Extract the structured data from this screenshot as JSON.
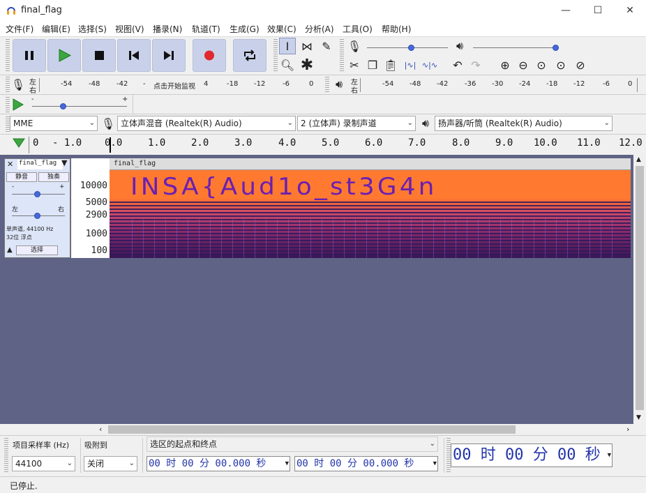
{
  "window": {
    "title": "final_flag",
    "minimize": "—",
    "maximize": "☐",
    "close": "✕"
  },
  "menu": [
    "文件(F)",
    "编辑(E)",
    "选择(S)",
    "视图(V)",
    "播录(N)",
    "轨道(T)",
    "生成(G)",
    "效果(C)",
    "分析(A)",
    "工具(O)",
    "帮助(H)"
  ],
  "transport": {
    "pause": "pause-icon",
    "play": "play-icon",
    "stop": "stop-icon",
    "skip_start": "skip-start-icon",
    "skip_end": "skip-end-icon",
    "record": "record-icon",
    "loop": "loop-icon"
  },
  "rec_meter": {
    "lr_top": "左",
    "lr_bottom": "右",
    "ticks": [
      "-54",
      "-48",
      "-42",
      "-",
      "4",
      "-18",
      "-12",
      "-6",
      "0"
    ],
    "prompt": "点击开始监视"
  },
  "play_meter": {
    "lr_top": "左",
    "lr_bottom": "右",
    "ticks": [
      "-54",
      "-48",
      "-42",
      "-36",
      "-30",
      "-24",
      "-18",
      "-12",
      "-6",
      "0"
    ]
  },
  "devices": {
    "host": "MME",
    "rec_device": "立体声混音 (Realtek(R) Audio)",
    "channels": "2 (立体声) 录制声道",
    "play_device": "扬声器/听筒 (Realtek(R) Audio)"
  },
  "ruler": {
    "labels": [
      "0",
      "- 1.0",
      "0.0",
      "1.0",
      "2.0",
      "3.0",
      "4.0",
      "5.0",
      "6.0",
      "7.0",
      "8.0",
      "9.0",
      "10.0",
      "11.0",
      "12.0"
    ]
  },
  "track": {
    "name": "final_flag",
    "mute": "静音",
    "solo": "独奏",
    "gain_minus": "-",
    "gain_plus": "+",
    "pan_left": "左",
    "pan_right": "右",
    "info1": "单声道, 44100 Hz",
    "info2": "32位 浮点",
    "select": "选择",
    "clip_name": "final_flag",
    "freq_labels": [
      "10000",
      "5000",
      "2900",
      "1000",
      "100"
    ],
    "spectrogram_text": "INSA{Aud1o_st3G4n"
  },
  "bottom": {
    "rate_label": "项目采样率 (Hz)",
    "rate_value": "44100",
    "snap_label": "吸附到",
    "snap_value": "关闭",
    "selection_label": "选区的起点和终点",
    "sel_start": "00 时 00 分 00.000 秒",
    "sel_end": "00 时 00 分 00.000 秒",
    "audio_pos": "00 时 00 分 00 秒"
  },
  "status": {
    "text": "已停止."
  },
  "colors": {
    "accent": "#4769d8",
    "spectro_bg": "#ff7a30",
    "track_bg": "#5f6385",
    "button_bg": "#c9d1ea",
    "flag_text": "#6a1fb3"
  }
}
